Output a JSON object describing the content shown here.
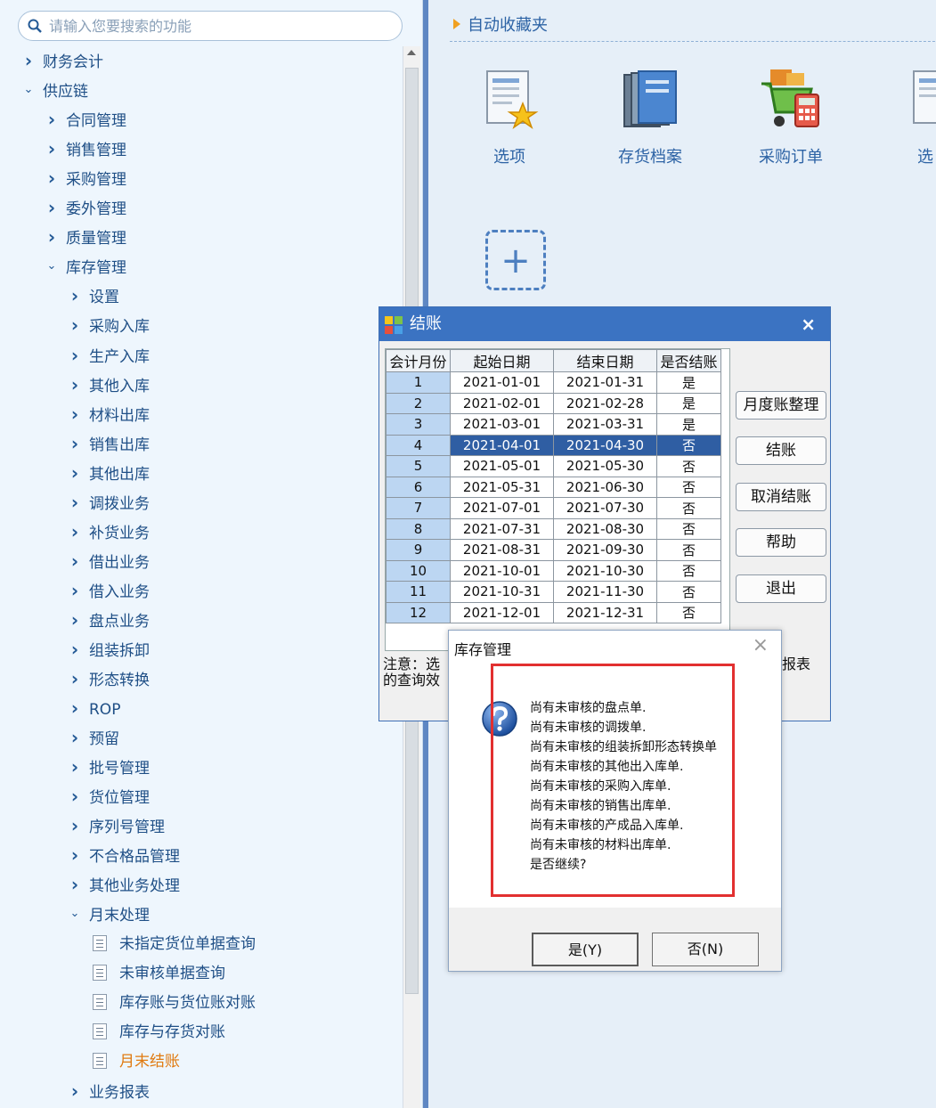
{
  "search": {
    "placeholder": "请输入您要搜索的功能"
  },
  "tree": [
    {
      "label": "财务会计",
      "level": 0,
      "kind": "collapsed"
    },
    {
      "label": "供应链",
      "level": 0,
      "kind": "expanded"
    },
    {
      "label": "合同管理",
      "level": 1,
      "kind": "collapsed"
    },
    {
      "label": "销售管理",
      "level": 1,
      "kind": "collapsed"
    },
    {
      "label": "采购管理",
      "level": 1,
      "kind": "collapsed"
    },
    {
      "label": "委外管理",
      "level": 1,
      "kind": "collapsed"
    },
    {
      "label": "质量管理",
      "level": 1,
      "kind": "collapsed"
    },
    {
      "label": "库存管理",
      "level": 1,
      "kind": "expanded"
    },
    {
      "label": "设置",
      "level": 2,
      "kind": "collapsed"
    },
    {
      "label": "采购入库",
      "level": 2,
      "kind": "collapsed"
    },
    {
      "label": "生产入库",
      "level": 2,
      "kind": "collapsed"
    },
    {
      "label": "其他入库",
      "level": 2,
      "kind": "collapsed"
    },
    {
      "label": "材料出库",
      "level": 2,
      "kind": "collapsed"
    },
    {
      "label": "销售出库",
      "level": 2,
      "kind": "collapsed"
    },
    {
      "label": "其他出库",
      "level": 2,
      "kind": "collapsed"
    },
    {
      "label": "调拨业务",
      "level": 2,
      "kind": "collapsed"
    },
    {
      "label": "补货业务",
      "level": 2,
      "kind": "collapsed"
    },
    {
      "label": "借出业务",
      "level": 2,
      "kind": "collapsed"
    },
    {
      "label": "借入业务",
      "level": 2,
      "kind": "collapsed"
    },
    {
      "label": "盘点业务",
      "level": 2,
      "kind": "collapsed"
    },
    {
      "label": "组装拆卸",
      "level": 2,
      "kind": "collapsed"
    },
    {
      "label": "形态转换",
      "level": 2,
      "kind": "collapsed"
    },
    {
      "label": "ROP",
      "level": 2,
      "kind": "collapsed"
    },
    {
      "label": "预留",
      "level": 2,
      "kind": "collapsed"
    },
    {
      "label": "批号管理",
      "level": 2,
      "kind": "collapsed"
    },
    {
      "label": "货位管理",
      "level": 2,
      "kind": "collapsed"
    },
    {
      "label": "序列号管理",
      "level": 2,
      "kind": "collapsed"
    },
    {
      "label": "不合格品管理",
      "level": 2,
      "kind": "collapsed"
    },
    {
      "label": "其他业务处理",
      "level": 2,
      "kind": "collapsed"
    },
    {
      "label": "月末处理",
      "level": 2,
      "kind": "expanded"
    },
    {
      "label": "未指定货位单据查询",
      "level": 3,
      "kind": "doc"
    },
    {
      "label": "未审核单据查询",
      "level": 3,
      "kind": "doc"
    },
    {
      "label": "库存账与货位账对账",
      "level": 3,
      "kind": "doc"
    },
    {
      "label": "库存与存货对账",
      "level": 3,
      "kind": "doc"
    },
    {
      "label": "月末结账",
      "level": 3,
      "kind": "doc",
      "active": true
    },
    {
      "label": "业务报表",
      "level": 2,
      "kind": "collapsed"
    }
  ],
  "favorites": {
    "title": "自动收藏夹",
    "items": [
      {
        "label": "选项",
        "icon": "doc-star-icon"
      },
      {
        "label": "存货档案",
        "icon": "books-icon"
      },
      {
        "label": "采购订单",
        "icon": "cart-calculator-icon"
      },
      {
        "label": "选",
        "icon": "doc-star-icon"
      }
    ],
    "add": "+"
  },
  "closing_dialog": {
    "title": "结账",
    "close": "×",
    "columns": [
      "会计月份",
      "起始日期",
      "结束日期",
      "是否结账"
    ],
    "rows": [
      [
        "1",
        "2021-01-01",
        "2021-01-31",
        "是"
      ],
      [
        "2",
        "2021-02-01",
        "2021-02-28",
        "是"
      ],
      [
        "3",
        "2021-03-01",
        "2021-03-31",
        "是"
      ],
      [
        "4",
        "2021-04-01",
        "2021-04-30",
        "否"
      ],
      [
        "5",
        "2021-05-01",
        "2021-05-30",
        "否"
      ],
      [
        "6",
        "2021-05-31",
        "2021-06-30",
        "否"
      ],
      [
        "7",
        "2021-07-01",
        "2021-07-30",
        "否"
      ],
      [
        "8",
        "2021-07-31",
        "2021-08-30",
        "否"
      ],
      [
        "9",
        "2021-08-31",
        "2021-09-30",
        "否"
      ],
      [
        "10",
        "2021-10-01",
        "2021-10-30",
        "否"
      ],
      [
        "11",
        "2021-10-31",
        "2021-11-30",
        "否"
      ],
      [
        "12",
        "2021-12-01",
        "2021-12-31",
        "否"
      ]
    ],
    "selected_month": "4",
    "buttons": {
      "monthly_arrange": "月度账整理",
      "close_account": "结账",
      "cancel_close": "取消结账",
      "help": "帮助",
      "exit": "退出"
    },
    "note_line1": "注意：选",
    "note_line2": "的查询效",
    "note_right": "报表"
  },
  "message_box": {
    "title": "库存管理",
    "close": "×",
    "lines": [
      "尚有未审核的盘点单.",
      "尚有未审核的调拨单.",
      "尚有未审核的组装拆卸形态转换单",
      "尚有未审核的其他出入库单.",
      "尚有未审核的采购入库单.",
      "尚有未审核的销售出库单.",
      "尚有未审核的产成品入库单.",
      "尚有未审核的材料出库单.",
      "是否继续?"
    ],
    "yes": "是(Y)",
    "no": "否(N)"
  },
  "colors": {
    "accent": "#3b73c2",
    "selected_row": "#2f5ea3",
    "highlight_box": "#e23030",
    "active_item": "#e07a10"
  }
}
